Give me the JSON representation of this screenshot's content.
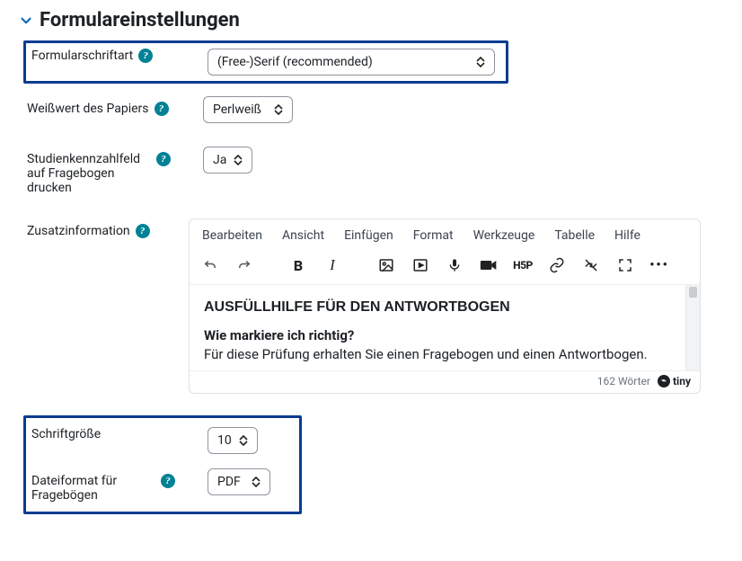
{
  "section": {
    "title": "Formulareinstellungen"
  },
  "fields": {
    "font": {
      "label": "Formularschriftart",
      "value": "(Free-)Serif (recommended)"
    },
    "white": {
      "label": "Weißwert des Papiers",
      "value": "Perlweiß"
    },
    "studyid": {
      "label": "Studienkennzahlfeld auf Fragebogen drucken",
      "value": "Ja"
    },
    "extra": {
      "label": "Zusatzinformation"
    },
    "size": {
      "label": "Schriftgröße",
      "value": "10"
    },
    "format": {
      "label": "Dateiformat für Fragebögen",
      "value": "PDF"
    }
  },
  "editor": {
    "menu": {
      "edit": "Bearbeiten",
      "view": "Ansicht",
      "insert": "Einfügen",
      "format": "Format",
      "tools": "Werkzeuge",
      "table": "Tabelle",
      "help": "Hilfe"
    },
    "toolbar": {
      "bold": "B",
      "italic": "I",
      "h5p": "H5P"
    },
    "content": {
      "heading": "AUSFÜLLHILFE FÜR DEN ANTWORTBOGEN",
      "q1": "Wie markiere ich richtig?",
      "p1": "Für diese Prüfung erhalten Sie einen Fragebogen und einen Antwortbogen."
    },
    "footer": {
      "wordcount": "162 Wörter",
      "brand": "tiny"
    }
  }
}
